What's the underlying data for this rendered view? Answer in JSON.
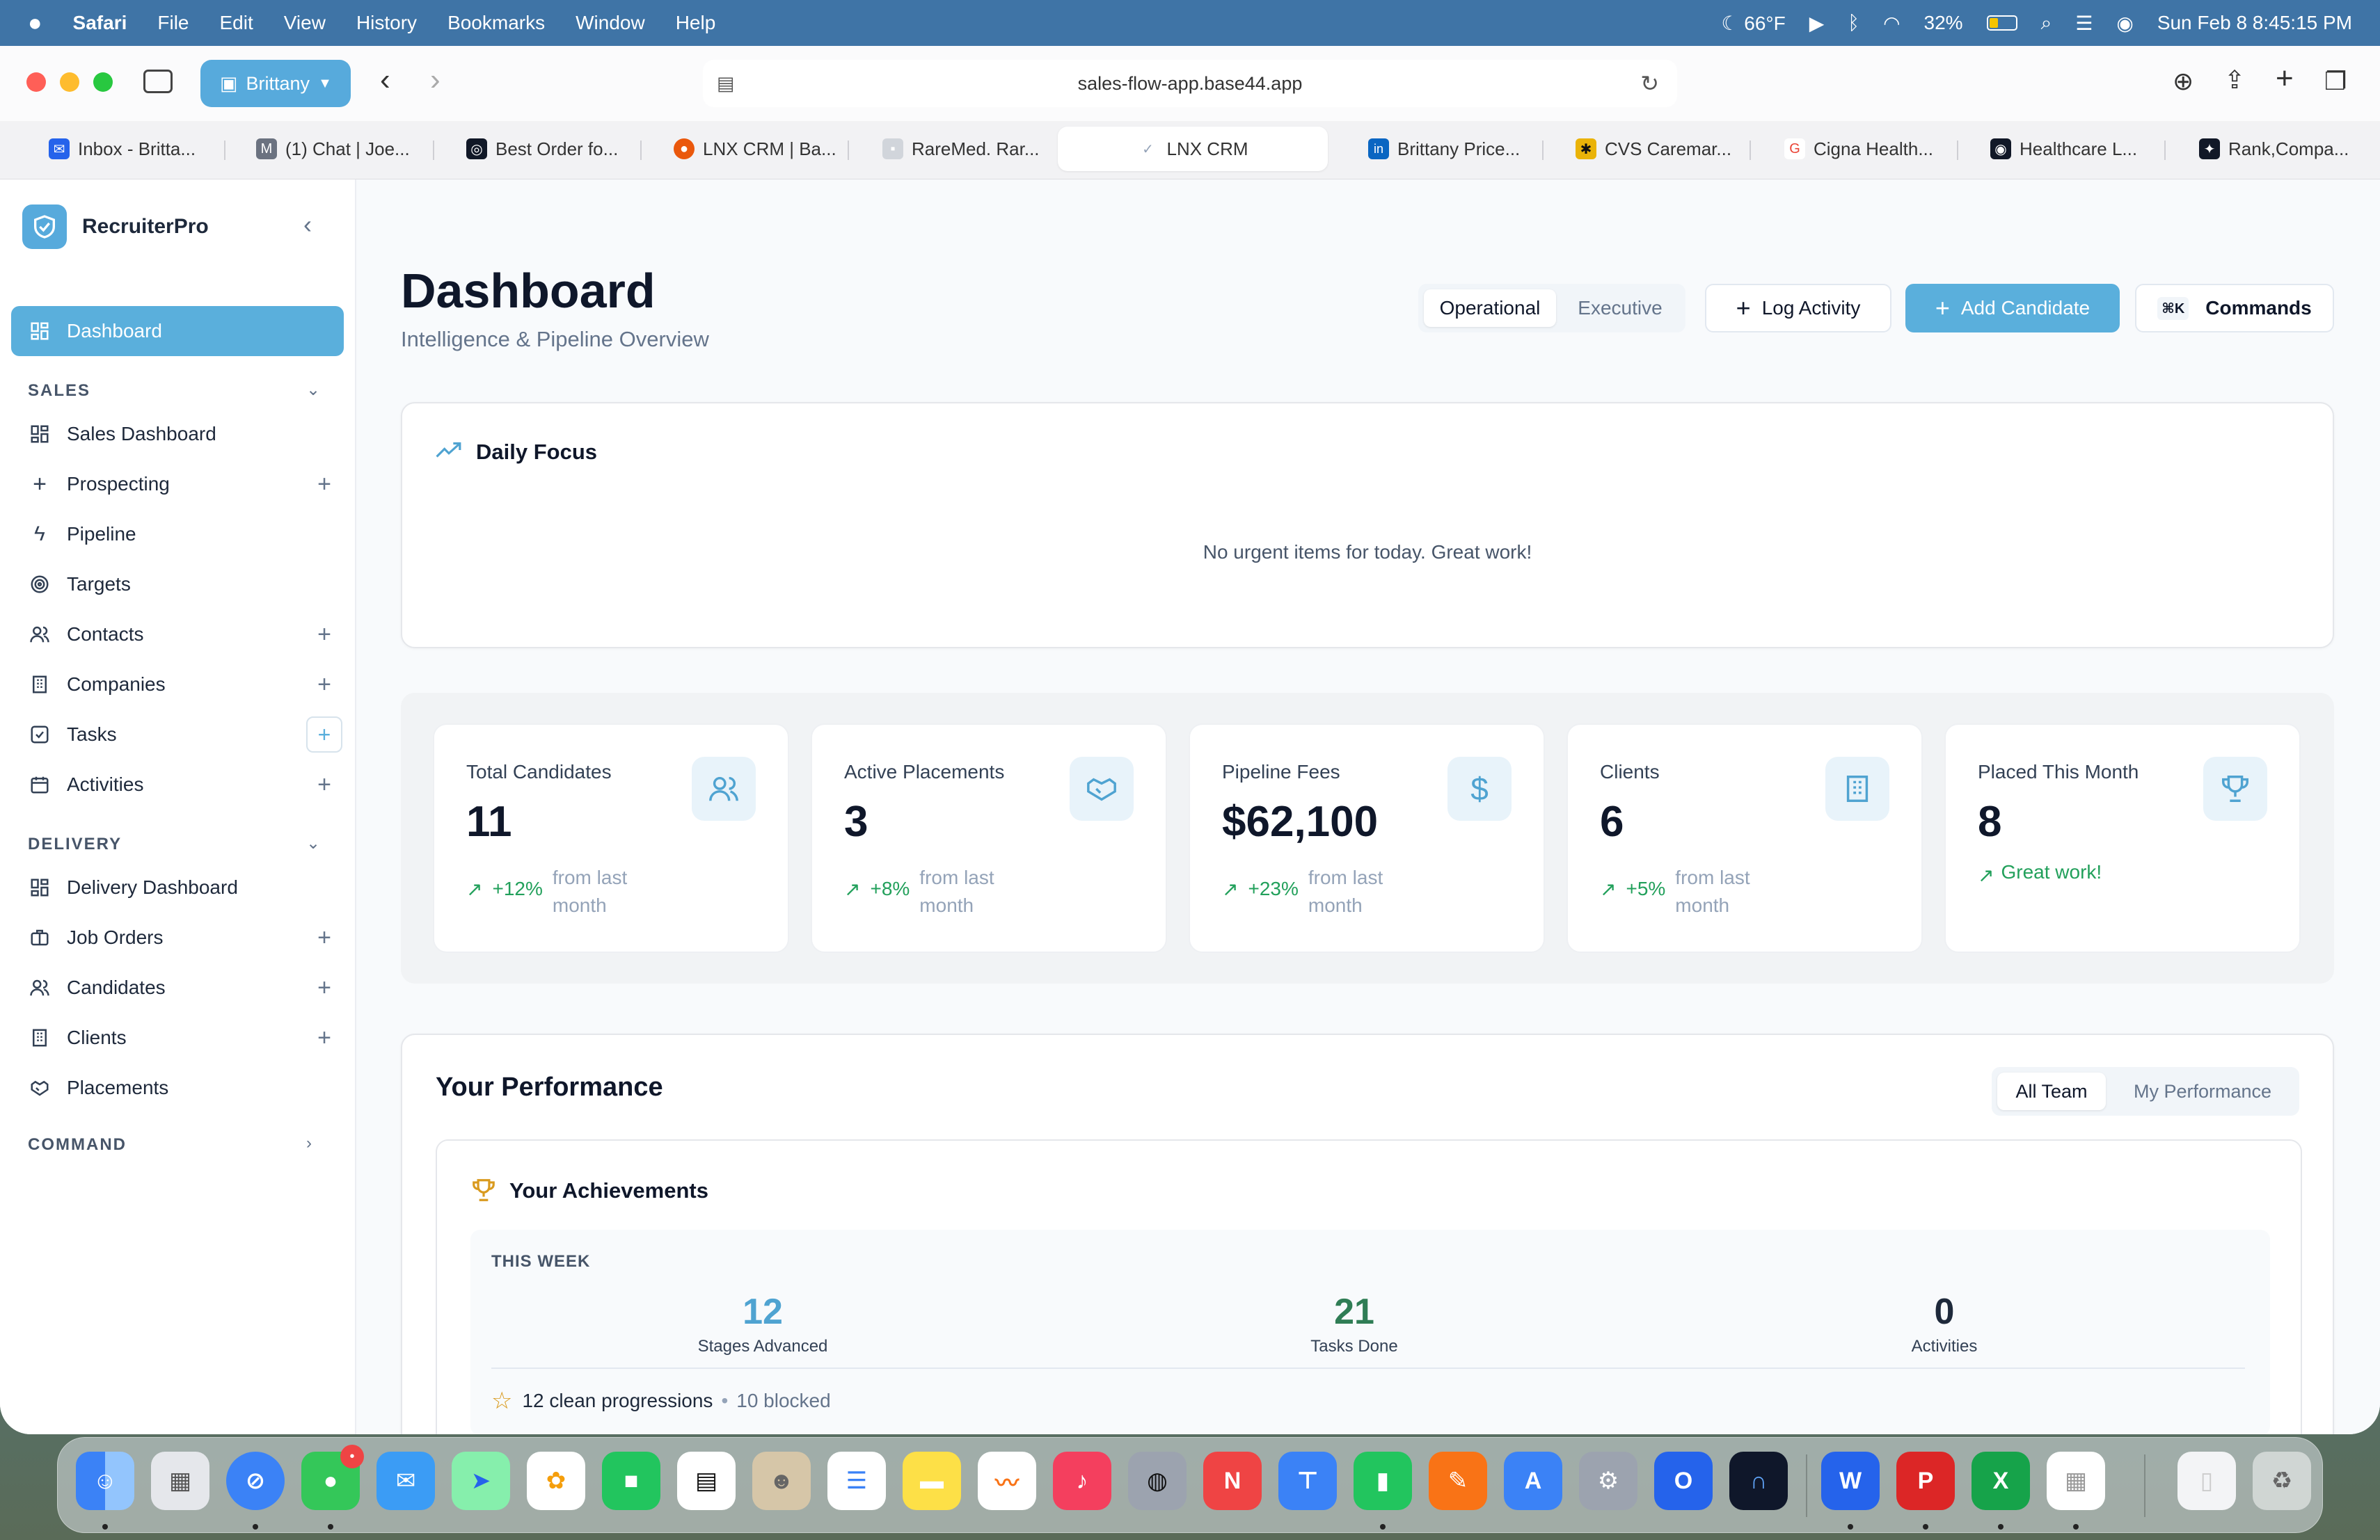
{
  "menubar": {
    "app_name": "Safari",
    "menus": [
      "File",
      "Edit",
      "View",
      "History",
      "Bookmarks",
      "Window",
      "Help"
    ],
    "weather": "66°F",
    "battery": "32%",
    "datetime": "Sun Feb 8  8:45:15 PM"
  },
  "browser": {
    "profile": "Brittany",
    "url": "sales-flow-app.base44.app",
    "tabs": [
      {
        "label": "Inbox - Britta...",
        "color": "#2563eb",
        "glyph": "✉"
      },
      {
        "label": "(1) Chat | Joe...",
        "color": "#6b7280",
        "glyph": "M"
      },
      {
        "label": "Best Order fo...",
        "color": "#111827",
        "glyph": "◎"
      },
      {
        "label": "LNX CRM | Ba...",
        "color": "#ea580c",
        "glyph": "●"
      },
      {
        "label": "RareMed. Rar...",
        "color": "#d1d5db",
        "glyph": "▪"
      },
      {
        "label": "LNX CRM",
        "color": "#94a3b8",
        "glyph": "✓"
      },
      {
        "label": "Brittany Price...",
        "color": "#0a66c2",
        "glyph": "in"
      },
      {
        "label": "CVS Caremar...",
        "color": "#eab308",
        "glyph": "✱"
      },
      {
        "label": "Cigna Health...",
        "color": "#ffffff",
        "glyph": "G"
      },
      {
        "label": "Healthcare L...",
        "color": "#111827",
        "glyph": "◉"
      },
      {
        "label": "Rank,Compa...",
        "color": "#111827",
        "glyph": "✦"
      }
    ]
  },
  "sidebar": {
    "brand": "RecruiterPro",
    "dashboard_label": "Dashboard",
    "sales_header": "SALES",
    "sales_items": [
      "Sales Dashboard",
      "Prospecting",
      "Pipeline",
      "Targets",
      "Contacts",
      "Companies",
      "Tasks",
      "Activities"
    ],
    "delivery_header": "DELIVERY",
    "delivery_items": [
      "Delivery Dashboard",
      "Job Orders",
      "Candidates",
      "Clients",
      "Placements"
    ],
    "command_header": "COMMAND"
  },
  "header": {
    "title": "Dashboard",
    "subtitle": "Intelligence & Pipeline Overview",
    "view_operational": "Operational",
    "view_executive": "Executive",
    "log_activity": "Log Activity",
    "add_candidate": "Add Candidate",
    "commands_shortcut": "⌘K",
    "commands": "Commands"
  },
  "daily_focus": {
    "title": "Daily Focus",
    "empty_message": "No urgent items for today. Great work!"
  },
  "stats": [
    {
      "label": "Total Candidates",
      "value": "11",
      "change": "+12%",
      "sub": "from last month",
      "icon": "users-icon"
    },
    {
      "label": "Active Placements",
      "value": "3",
      "change": "+8%",
      "sub": "from last month",
      "icon": "handshake-icon"
    },
    {
      "label": "Pipeline Fees",
      "value": "$62,100",
      "change": "+23%",
      "sub": "from last month",
      "icon": "dollar-icon"
    },
    {
      "label": "Clients",
      "value": "6",
      "change": "+5%",
      "sub": "from last month",
      "icon": "building-icon"
    },
    {
      "label": "Placed This Month",
      "value": "8",
      "change": "Great work!",
      "sub": "",
      "icon": "trophy-icon"
    }
  ],
  "performance": {
    "title": "Your Performance",
    "toggle_all": "All Team",
    "toggle_mine": "My Performance",
    "achievements_title": "Your Achievements",
    "week_label": "THIS WEEK",
    "metrics": [
      {
        "value": "12",
        "label": "Stages Advanced",
        "color": "#4fa3d1"
      },
      {
        "value": "21",
        "label": "Tasks Done",
        "color": "#2f7d55"
      },
      {
        "value": "0",
        "label": "Activities",
        "color": "#1e293b"
      }
    ],
    "progressions": "12 clean progressions",
    "blocked": "10 blocked"
  },
  "colors": {
    "accent": "#5aafdc",
    "trend_green": "#22a05b",
    "purple_bar": "#7c3aed"
  }
}
